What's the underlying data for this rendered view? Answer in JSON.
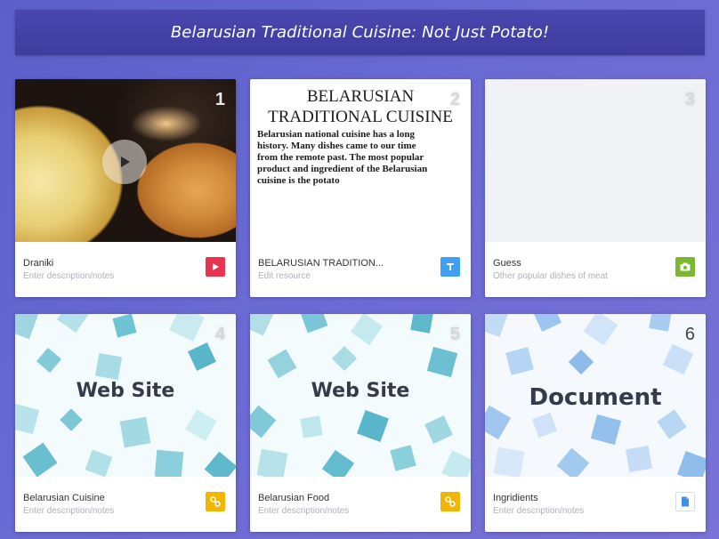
{
  "header": {
    "title": "Belarusian Traditional Cuisine: Not Just Potato!"
  },
  "tiles": [
    {
      "number": "1",
      "name": "Draniki",
      "note": "Enter description/notes",
      "type": "video",
      "badge_color": "#e8344e",
      "badge_icon": "play-icon"
    },
    {
      "number": "2",
      "name": "BELARUSIAN TRADITION...",
      "note": "Edit resource",
      "type": "text",
      "badge_color": "#3f9ff0",
      "badge_icon": "text-icon",
      "preview_heading": "BELARUSIAN TRADITIONAL CUISINE",
      "preview_body": "Belarusian national cuisine has a long history. Many dishes came to our time from the remote past. The most popular product and ingredient of the Belarusian cuisine is the potato"
    },
    {
      "number": "3",
      "name": "Guess",
      "note": "Other popular dishes of meat",
      "type": "image",
      "badge_color": "#7cb82f",
      "badge_icon": "camera-icon"
    },
    {
      "number": "4",
      "name": "Belarusian Cuisine",
      "note": "Enter description/notes",
      "type": "link",
      "badge_color": "#f2b600",
      "badge_icon": "link-icon",
      "preview_label": "Web Site"
    },
    {
      "number": "5",
      "name": "Belarusian Food",
      "note": "Enter description/notes",
      "type": "link",
      "badge_color": "#f2b600",
      "badge_icon": "link-icon",
      "preview_label": "Web Site"
    },
    {
      "number": "6",
      "name": "Ingridients",
      "note": "Enter description/notes",
      "type": "document",
      "badge_color": "#ffffff",
      "badge_icon": "document-icon",
      "preview_label": "Document"
    }
  ]
}
